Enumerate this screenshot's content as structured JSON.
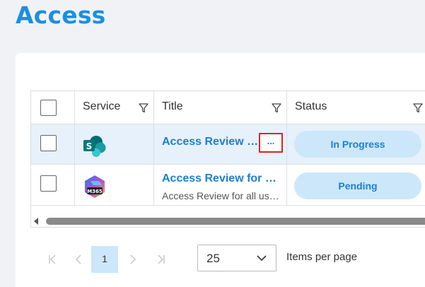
{
  "page": {
    "title": "Access"
  },
  "table": {
    "headers": {
      "service": "Service",
      "title": "Title",
      "status": "Status"
    },
    "rows": [
      {
        "service_icon": "sharepoint-icon",
        "title": "Access Review for SharePoint",
        "subtitle": "",
        "status": "In Progress"
      },
      {
        "service_icon": "m365-icon",
        "title": "Access Review for all users",
        "subtitle": "Access Review for all users",
        "status": "Pending"
      }
    ],
    "more_label": "..."
  },
  "pagination": {
    "first_icon": "first-page-icon",
    "prev_icon": "previous-page-icon",
    "current_page": "1",
    "next_icon": "next-page-icon",
    "last_icon": "last-page-icon",
    "page_size": "25",
    "page_size_label": "Items per page"
  },
  "colors": {
    "accent": "#1b8fe0",
    "link": "#1b7fd1",
    "pill_bg": "#cce7f9",
    "selected_row": "#e6f1fb",
    "highlight_border": "#d9261c"
  }
}
